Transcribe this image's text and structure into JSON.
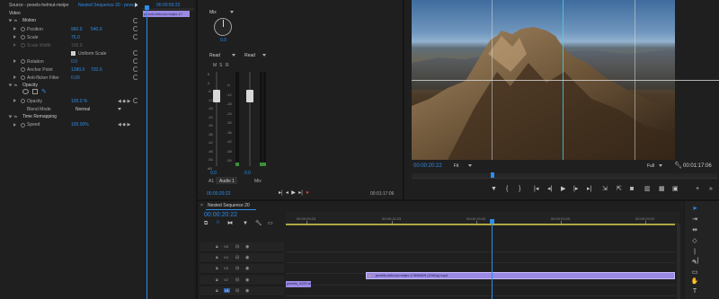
{
  "source_panel": {
    "tabs": [
      "Source - pexels-helmut-meijer",
      "Nested Sequence 20 - pexe..."
    ],
    "timecode": "00:00:59:22",
    "clip_label": "pexels-helmut-meijer-17",
    "section": "Video",
    "motion": {
      "title": "Motion",
      "position_label": "Position",
      "position_x": "960.0",
      "position_y": "540.0",
      "scale_label": "Scale",
      "scale": "75.0",
      "scale_width_label": "Scale Width",
      "scale_width": "100.0",
      "uniform_label": "Uniform Scale",
      "rotation_label": "Rotation",
      "rotation": "0.0",
      "anchor_label": "Anchor Point",
      "anchor_x": "1280.0",
      "anchor_y": "720.0",
      "antiflicker_label": "Anti-flicker Filter",
      "antiflicker": "0.00"
    },
    "opacity": {
      "title": "Opacity",
      "opacity_label": "Opacity",
      "opacity": "100.0 %",
      "blend_label": "Blend Mode",
      "blend": "Normal"
    },
    "time_remap": {
      "title": "Time Remapping",
      "speed_label": "Speed",
      "speed": "100.00%"
    }
  },
  "mixer": {
    "mix_label": "Mix",
    "read_left": "Read",
    "read_right": "Read",
    "knob_value": "0.0",
    "left_value": "0.0",
    "right_value": "0.0",
    "channel_a1": "A1",
    "channel_audio": "Audio 1",
    "channel_mix": "Mix",
    "db_ticks": [
      "6",
      "0",
      "-6",
      "-12",
      "-18",
      "-24",
      "-30",
      "-36",
      "-42",
      "-48",
      "-54",
      "dB"
    ],
    "meter_ticks": [
      "-6",
      "-12",
      "-18",
      "-24",
      "-30",
      "-36",
      "-42",
      "-48",
      "-54"
    ],
    "timecode_left": "00:00:20:22",
    "timecode_right": "00:01:17:06",
    "ms_labels": [
      "M",
      "S",
      "R"
    ]
  },
  "program": {
    "timecode": "00:00:20:22",
    "zoom": "Fit",
    "quality": "Full",
    "duration": "00:01:17:06"
  },
  "timeline": {
    "tab": "Nested Sequence 20",
    "timecode": "00:00:20:22",
    "ruler": [
      "00:00:09:23",
      "00:00:14:23",
      "00:00:19:23",
      "00:00:24:23",
      "00:00:29:23"
    ],
    "tracks": [
      {
        "name": "V7"
      },
      {
        "name": "V6"
      },
      {
        "name": "V5"
      },
      {
        "name": "V4"
      },
      {
        "name": "V3"
      },
      {
        "name": "V2"
      },
      {
        "name": "V1"
      }
    ],
    "v_clip": "pexels-helmut-meijer-17695629 (2160p).mp4",
    "a_clip": "pexels_4120.mov",
    "v1_label": "V1",
    "audio_col_a": "V4",
    "audio_col_b": "V1"
  },
  "colors": {
    "accent": "#2d8ceb",
    "clip_purple": "#9b8ae3",
    "playhead": "#2d8ceb",
    "record": "#e03c3c"
  }
}
